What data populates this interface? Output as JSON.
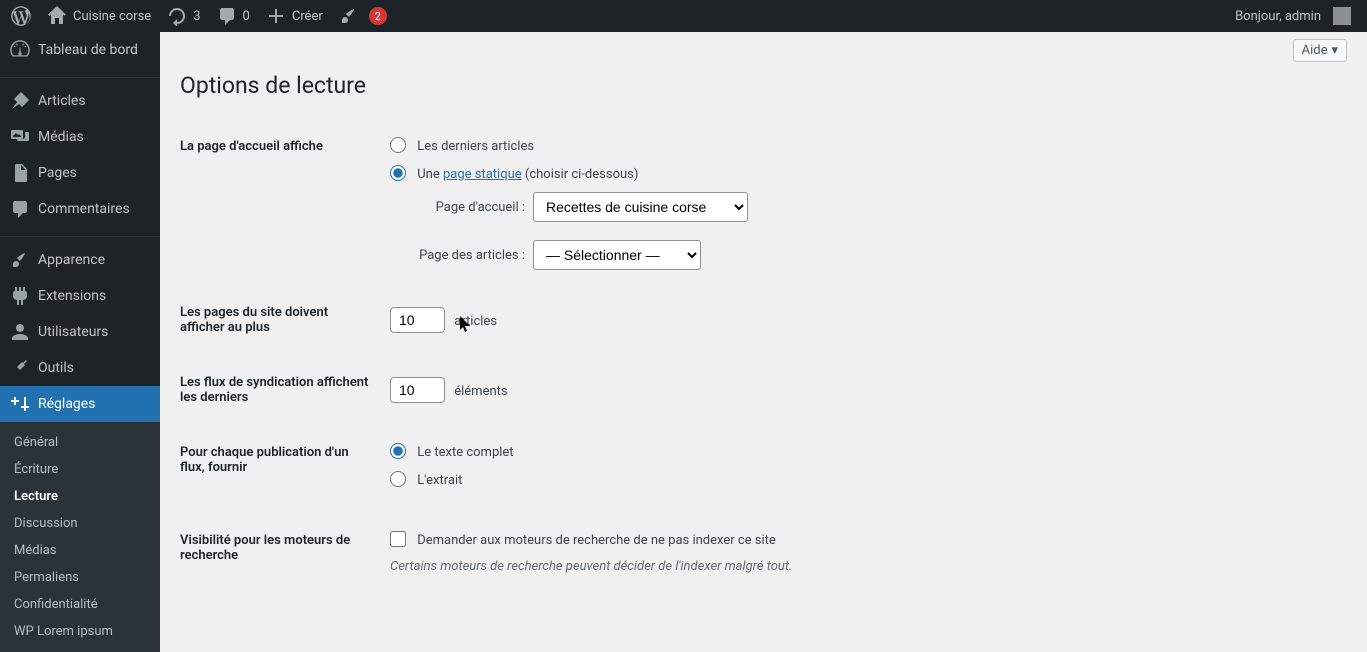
{
  "adminbar": {
    "site_name": "Cuisine corse",
    "updates_count": "3",
    "comments_count": "0",
    "new_label": "Créer",
    "wpml_badge": "2",
    "greeting": "Bonjour, admin"
  },
  "sidebar": {
    "dashboard": "Tableau de bord",
    "posts": "Articles",
    "media": "Médias",
    "pages": "Pages",
    "comments": "Commentaires",
    "appearance": "Apparence",
    "plugins": "Extensions",
    "users": "Utilisateurs",
    "tools": "Outils",
    "settings": "Réglages",
    "submenu": {
      "general": "Général",
      "writing": "Écriture",
      "reading": "Lecture",
      "discussion": "Discussion",
      "media": "Médias",
      "permalinks": "Permaliens",
      "privacy": "Confidentialité",
      "wplorem": "WP Lorem ipsum"
    }
  },
  "content": {
    "help": "Aide",
    "page_title": "Options de lecture",
    "front_page_displays": "La page d'accueil affiche",
    "option_latest": "Les derniers articles",
    "option_static_prefix": "Une ",
    "option_static_link": "page statique",
    "option_static_suffix": " (choisir ci-dessous)",
    "homepage_label": "Page d'accueil :",
    "homepage_value": "Recettes de cuisine corse",
    "posts_page_label": "Page des articles :",
    "posts_page_value": "— Sélectionner —",
    "blog_pages_show": "Les pages du site doivent afficher au plus",
    "posts_per_page": "10",
    "posts_unit": "articles",
    "syndication_label": "Les flux de syndication affichent les derniers",
    "posts_per_rss": "10",
    "rss_unit": "éléments",
    "feed_content_label": "Pour chaque publication d'un flux, fournir",
    "feed_full": "Le texte complet",
    "feed_excerpt": "L'extrait",
    "search_visibility": "Visibilité pour les moteurs de recherche",
    "discourage_checkbox": "Demander aux moteurs de recherche de ne pas indexer ce site",
    "discourage_desc": "Certains moteurs de recherche peuvent décider de l'indexer malgré tout."
  }
}
